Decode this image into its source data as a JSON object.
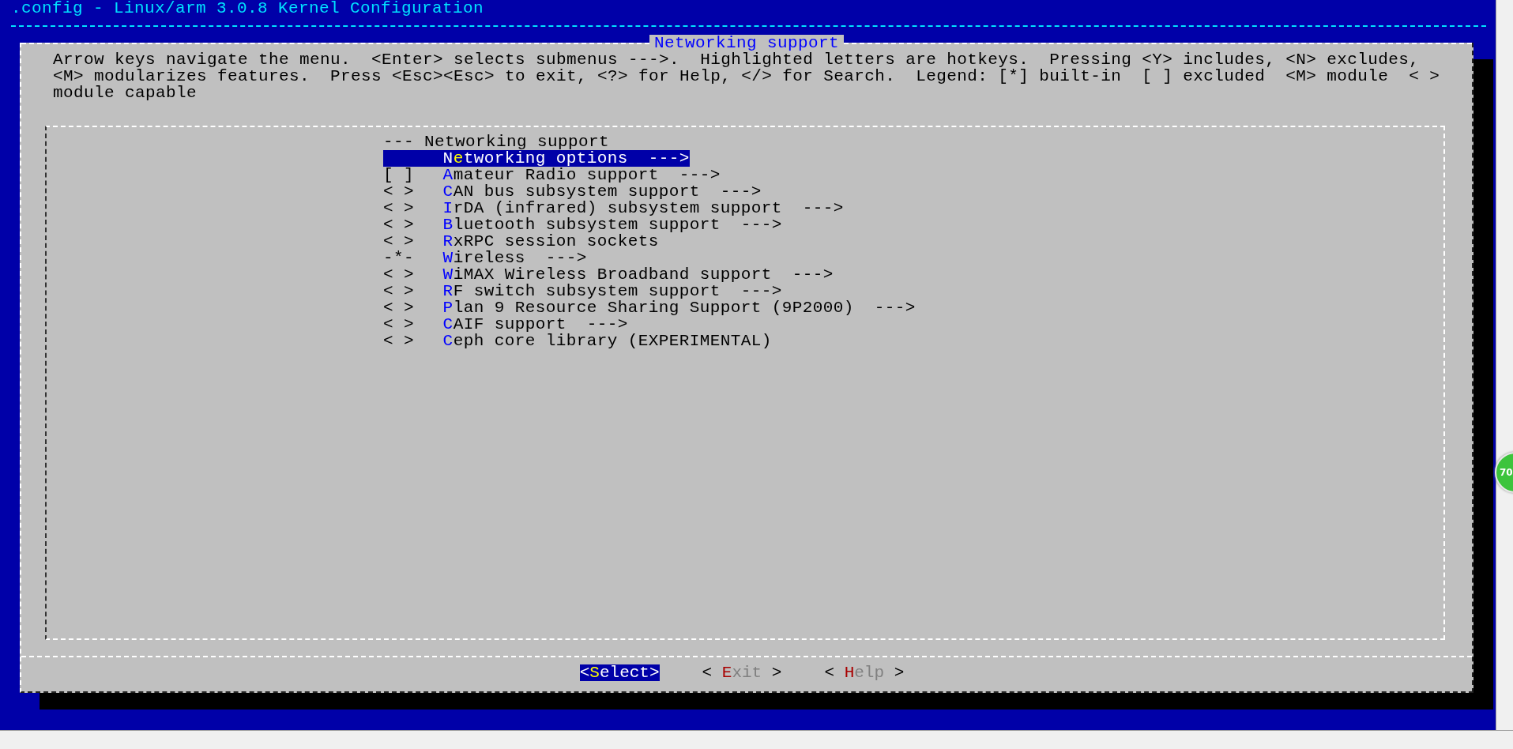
{
  "window": {
    "title": ".config - Linux/arm 3.0.8 Kernel Configuration"
  },
  "dialog": {
    "title": "Networking support",
    "help": "Arrow keys navigate the menu.  <Enter> selects submenus --->.  Highlighted letters are hotkeys.  Pressing <Y> includes, <N> excludes,\n<M> modularizes features.  Press <Esc><Esc> to exit, <?> for Help, </> for Search.  Legend: [*] built-in  [ ] excluded  <M> module  < >\nmodule capable"
  },
  "menu": {
    "items": [
      {
        "kind": "header",
        "text": "--- Networking support"
      },
      {
        "kind": "entry",
        "selected": true,
        "before": "N",
        "hotkey": "e",
        "after": "tworking options  --->"
      },
      {
        "kind": "entry",
        "selected": false,
        "prefix": "[ ]",
        "hotkey": "A",
        "after": "mateur Radio support  --->"
      },
      {
        "kind": "entry",
        "selected": false,
        "prefix": "< >",
        "hotkey": "C",
        "after": "AN bus subsystem support  --->"
      },
      {
        "kind": "entry",
        "selected": false,
        "prefix": "< >",
        "hotkey": "I",
        "after": "rDA (infrared) subsystem support  --->"
      },
      {
        "kind": "entry",
        "selected": false,
        "prefix": "< >",
        "hotkey": "B",
        "after": "luetooth subsystem support  --->"
      },
      {
        "kind": "entry",
        "selected": false,
        "prefix": "< >",
        "hotkey": "R",
        "after": "xRPC session sockets"
      },
      {
        "kind": "entry",
        "selected": false,
        "prefix": "-*-",
        "hotkey": "W",
        "after": "ireless  --->"
      },
      {
        "kind": "entry",
        "selected": false,
        "prefix": "< >",
        "hotkey": "W",
        "after": "iMAX Wireless Broadband support  --->"
      },
      {
        "kind": "entry",
        "selected": false,
        "prefix": "< >",
        "hotkey": "R",
        "after": "F switch subsystem support  --->"
      },
      {
        "kind": "entry",
        "selected": false,
        "prefix": "< >",
        "hotkey": "P",
        "after": "lan 9 Resource Sharing Support (9P2000)  --->"
      },
      {
        "kind": "entry",
        "selected": false,
        "prefix": "< >",
        "hotkey": "C",
        "after": "AIF support  --->"
      },
      {
        "kind": "entry",
        "selected": false,
        "prefix": "< >",
        "hotkey": "C",
        "after": "eph core library (EXPERIMENTAL)"
      }
    ]
  },
  "buttons": [
    {
      "open": "<",
      "hotkey": "S",
      "rest": "elect",
      "close": ">",
      "selected": true
    },
    {
      "open": "< ",
      "hotkey": "E",
      "rest": "xit",
      "close": " >",
      "selected": false
    },
    {
      "open": "< ",
      "hotkey": "H",
      "rest": "elp",
      "close": " >",
      "selected": false
    }
  ],
  "overlay_badge": {
    "text": "70"
  }
}
